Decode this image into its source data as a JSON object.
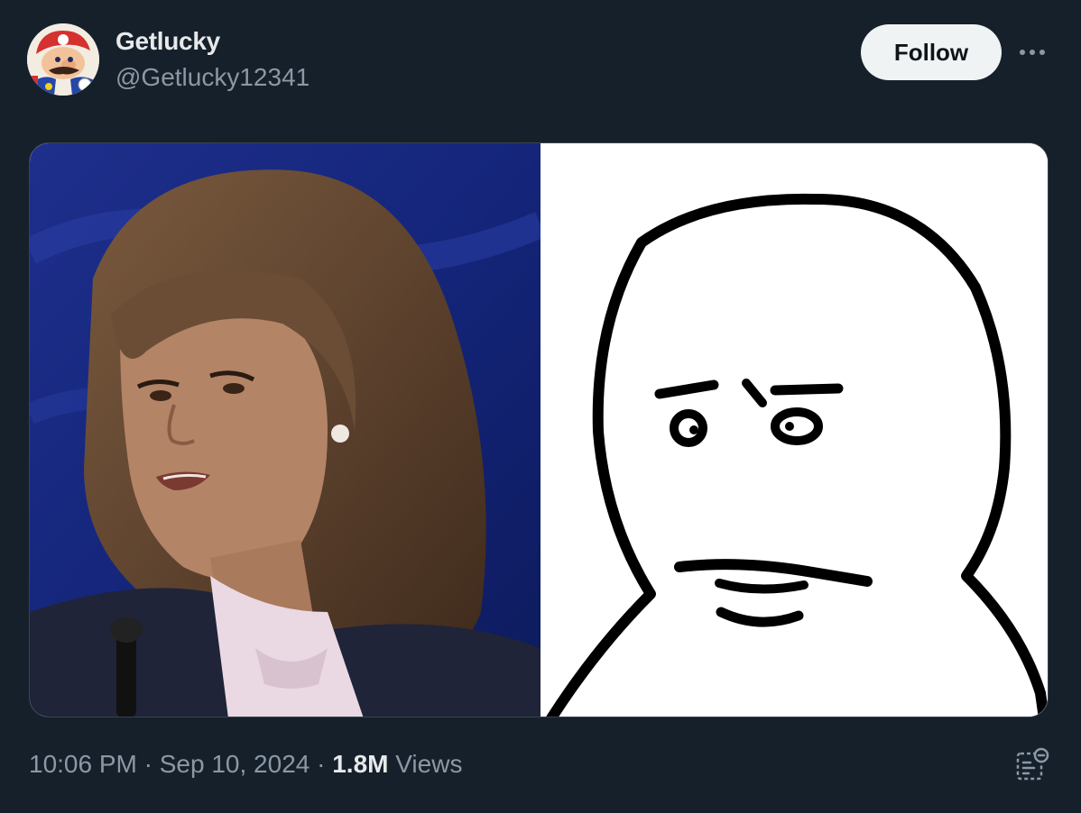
{
  "tweet": {
    "author": {
      "display_name": "Getlucky",
      "handle": "@Getlucky12341",
      "avatar_icon": "mario-avatar"
    },
    "follow_label": "Follow",
    "more_icon": "ellipsis-icon",
    "media": {
      "left_image": "photo-woman-speaking",
      "right_image": "drawn-meme-face"
    },
    "meta": {
      "time": "10:06 PM",
      "separator": "·",
      "date": "Sep 10, 2024",
      "views_count": "1.8M",
      "views_label": "Views"
    },
    "analytics_icon": "analytics-icon"
  },
  "colors": {
    "background": "#15202b",
    "primary_text": "#e7e9ea",
    "secondary_text": "#8b98a5",
    "follow_button_bg": "#eff3f4"
  }
}
